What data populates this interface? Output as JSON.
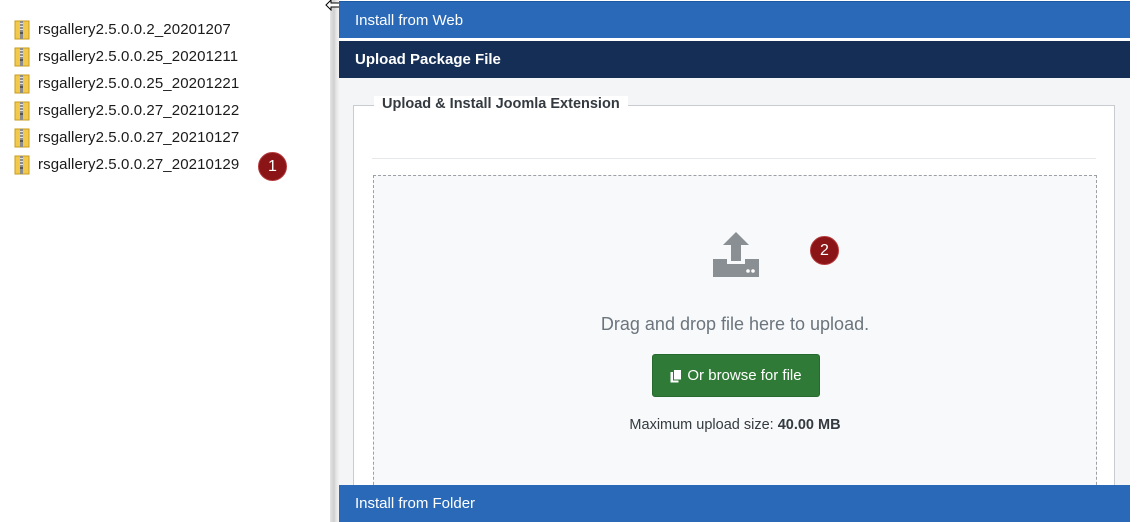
{
  "explorer": {
    "files": [
      "rsgallery2.5.0.0.2_20201207",
      "rsgallery2.5.0.0.25_20201211",
      "rsgallery2.5.0.0.25_20201221",
      "rsgallery2.5.0.0.27_20210122",
      "rsgallery2.5.0.0.27_20210127",
      "rsgallery2.5.0.0.27_20210129"
    ],
    "icon": "zip-folder-icon"
  },
  "badges": {
    "one": "1",
    "two": "2",
    "color": "#8b1416"
  },
  "installer": {
    "tab_web": "Install from Web",
    "tab_upload": "Upload Package File",
    "tab_folder": "Install from Folder",
    "legend": "Upload & Install Joomla Extension",
    "drop_text": "Drag and drop file here to upload.",
    "browse_label": "Or browse for file",
    "max_label": "Maximum upload size:",
    "max_value": "40.00 MB",
    "colors": {
      "tab": "#2a69b8",
      "active_tab": "#142e56",
      "button": "#2f7a36"
    }
  }
}
